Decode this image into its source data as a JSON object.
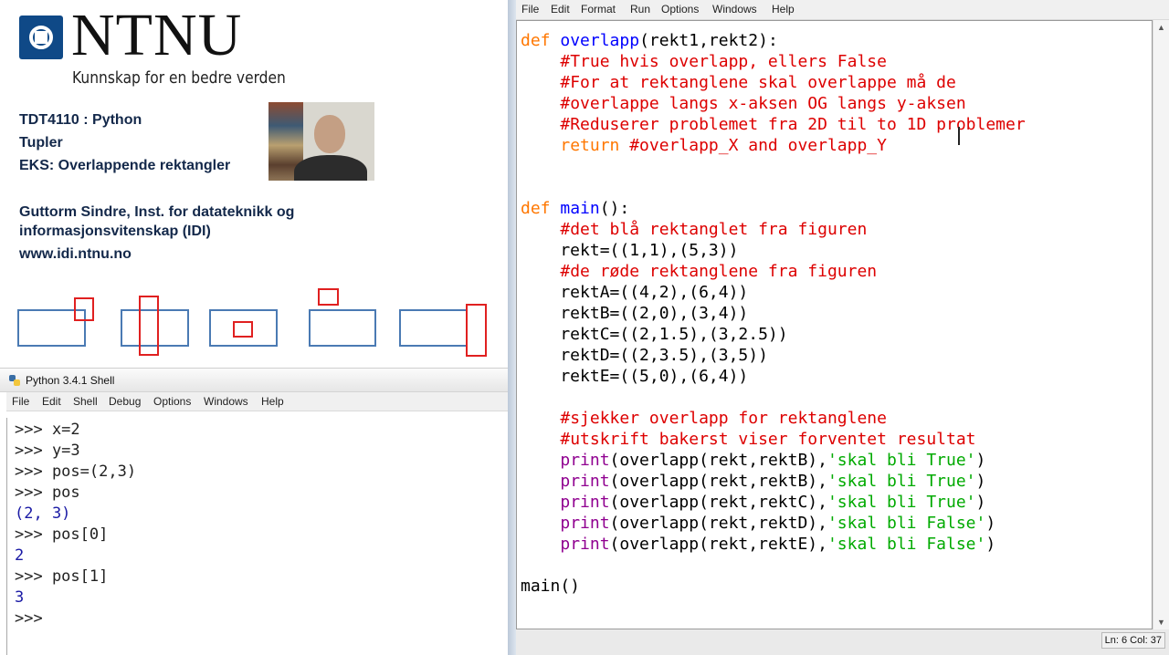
{
  "slide": {
    "logo_text": "NTNU",
    "logo_tagline": "Kunnskap for en bedre verden",
    "course": "TDT4110 : Python",
    "topic": "Tupler",
    "example": "EKS: Overlappende rektangler",
    "author_line1": "Guttorm Sindre, Inst. for datateknikk og",
    "author_line2": "informasjonsvitenskap (IDI)",
    "website": "www.idi.ntnu.no",
    "colors": {
      "logo_blue": "#0f4987",
      "text": "#13284a",
      "blue_rect": "#4a7ab3",
      "red_rect": "#e02020"
    }
  },
  "shell": {
    "title": "Python 3.4.1 Shell",
    "menu": [
      "File",
      "Edit",
      "Shell",
      "Debug",
      "Options",
      "Windows",
      "Help"
    ],
    "lines": [
      {
        "kind": "input",
        "text": ">>> x=2"
      },
      {
        "kind": "input",
        "text": ">>> y=3"
      },
      {
        "kind": "input",
        "text": ">>> pos=(2,3)"
      },
      {
        "kind": "input",
        "text": ">>> pos"
      },
      {
        "kind": "output",
        "text": "(2, 3)"
      },
      {
        "kind": "input",
        "text": ">>> pos[0]"
      },
      {
        "kind": "output",
        "text": "2"
      },
      {
        "kind": "input",
        "text": ">>> pos[1]"
      },
      {
        "kind": "output",
        "text": "3"
      },
      {
        "kind": "input",
        "text": ">>> "
      }
    ]
  },
  "editor": {
    "menu": [
      "File",
      "Edit",
      "Format",
      "Run",
      "Options",
      "Windows",
      "Help"
    ],
    "status": "Ln: 6 Col: 37",
    "code": [
      [
        [
          "kw",
          "def "
        ],
        [
          "fn",
          "overlapp"
        ],
        [
          "t",
          "(rekt1,rekt2):"
        ]
      ],
      [
        [
          "t",
          "    "
        ],
        [
          "cm",
          "#True hvis overlapp, ellers False"
        ]
      ],
      [
        [
          "t",
          "    "
        ],
        [
          "cm",
          "#For at rektanglene skal overlappe må de"
        ]
      ],
      [
        [
          "t",
          "    "
        ],
        [
          "cm",
          "#overlappe langs x-aksen OG langs y-aksen"
        ]
      ],
      [
        [
          "t",
          "    "
        ],
        [
          "cm",
          "#Reduserer problemet fra 2D til to 1D problemer"
        ]
      ],
      [
        [
          "t",
          "    "
        ],
        [
          "kw",
          "return "
        ],
        [
          "cm",
          "#overlapp_X and overlapp_Y"
        ]
      ],
      [],
      [],
      [
        [
          "kw",
          "def "
        ],
        [
          "fn",
          "main"
        ],
        [
          "t",
          "():"
        ]
      ],
      [
        [
          "t",
          "    "
        ],
        [
          "cm",
          "#det blå rektanglet fra figuren"
        ]
      ],
      [
        [
          "t",
          "    rekt=((1,1),(5,3))"
        ]
      ],
      [
        [
          "t",
          "    "
        ],
        [
          "cm",
          "#de røde rektanglene fra figuren"
        ]
      ],
      [
        [
          "t",
          "    rektA=((4,2),(6,4))"
        ]
      ],
      [
        [
          "t",
          "    rektB=((2,0),(3,4))"
        ]
      ],
      [
        [
          "t",
          "    rektC=((2,1.5),(3,2.5))"
        ]
      ],
      [
        [
          "t",
          "    rektD=((2,3.5),(3,5))"
        ]
      ],
      [
        [
          "t",
          "    rektE=((5,0),(6,4))"
        ]
      ],
      [],
      [
        [
          "t",
          "    "
        ],
        [
          "cm",
          "#sjekker overlapp for rektanglene"
        ]
      ],
      [
        [
          "t",
          "    "
        ],
        [
          "cm",
          "#utskrift bakerst viser forventet resultat"
        ]
      ],
      [
        [
          "t",
          "    "
        ],
        [
          "bi",
          "print"
        ],
        [
          "t",
          "(overlapp(rekt,rektB),"
        ],
        [
          "st",
          "'skal bli True'"
        ],
        [
          "t",
          ")"
        ]
      ],
      [
        [
          "t",
          "    "
        ],
        [
          "bi",
          "print"
        ],
        [
          "t",
          "(overlapp(rekt,rektB),"
        ],
        [
          "st",
          "'skal bli True'"
        ],
        [
          "t",
          ")"
        ]
      ],
      [
        [
          "t",
          "    "
        ],
        [
          "bi",
          "print"
        ],
        [
          "t",
          "(overlapp(rekt,rektC),"
        ],
        [
          "st",
          "'skal bli True'"
        ],
        [
          "t",
          ")"
        ]
      ],
      [
        [
          "t",
          "    "
        ],
        [
          "bi",
          "print"
        ],
        [
          "t",
          "(overlapp(rekt,rektD),"
        ],
        [
          "st",
          "'skal bli False'"
        ],
        [
          "t",
          ")"
        ]
      ],
      [
        [
          "t",
          "    "
        ],
        [
          "bi",
          "print"
        ],
        [
          "t",
          "(overlapp(rekt,rektE),"
        ],
        [
          "st",
          "'skal bli False'"
        ],
        [
          "t",
          ")"
        ]
      ],
      [],
      [
        [
          "t",
          "main()"
        ]
      ]
    ]
  }
}
